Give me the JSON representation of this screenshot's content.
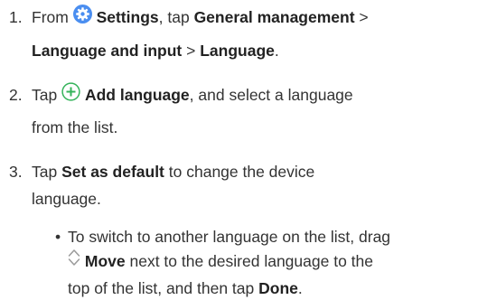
{
  "steps": [
    {
      "num": "1.",
      "l1_a": "From",
      "l1_b": "Settings",
      "l1_c": ", tap",
      "l1_d": "General management",
      "l1_e": ">",
      "l2_a": "Language and input",
      "l2_b": ">",
      "l2_c": "Language",
      "l2_d": "."
    },
    {
      "num": "2.",
      "l1_a": "Tap",
      "l1_b": "Add language",
      "l1_c": ", and select a language",
      "l2_a": "from the list."
    },
    {
      "num": "3.",
      "l1_a": "Tap",
      "l1_b": "Set as default",
      "l1_c": "to change the device",
      "l2_a": "language."
    }
  ],
  "bullet": {
    "mark": "•",
    "l1": "To switch to another language on the list, drag",
    "l2_b": "Move",
    "l2_c": "next to the desired language to the",
    "l3_a": "top of the list, and then tap",
    "l3_b": "Done",
    "l3_c": "."
  },
  "icons": {
    "settings": "settings-gear-icon",
    "add": "add-plus-icon",
    "move": "move-up-down-icon"
  },
  "colors": {
    "settings_icon_bg": "#4a8ef0",
    "add_icon_green": "#34b35a",
    "move_icon_gray": "#9a9a9a"
  }
}
